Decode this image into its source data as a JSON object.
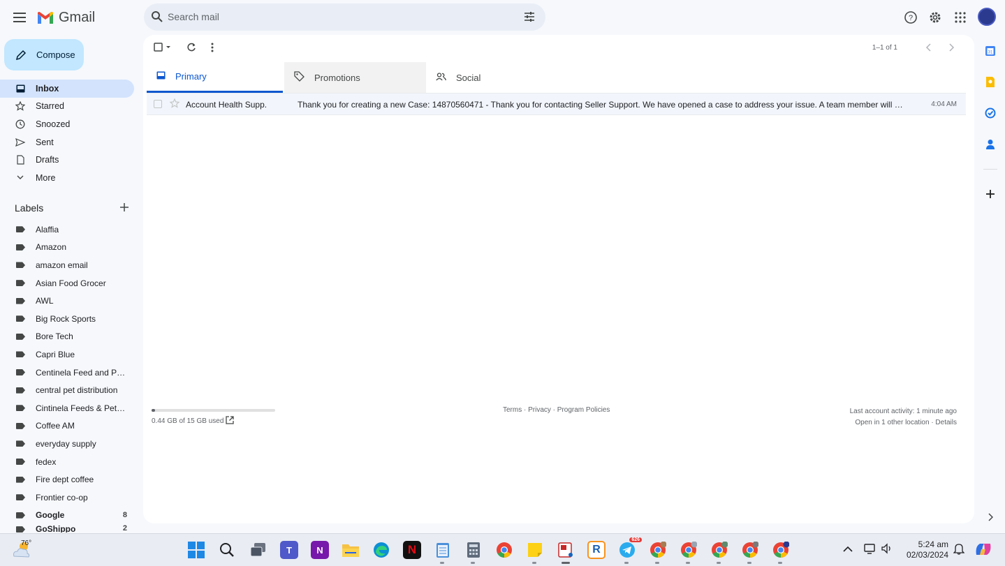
{
  "header": {
    "brand": "Gmail",
    "search_placeholder": "Search mail"
  },
  "compose_label": "Compose",
  "nav": [
    {
      "label": "Inbox",
      "icon": "inbox-icon",
      "active": true
    },
    {
      "label": "Starred",
      "icon": "star-icon"
    },
    {
      "label": "Snoozed",
      "icon": "clock-icon"
    },
    {
      "label": "Sent",
      "icon": "send-icon"
    },
    {
      "label": "Drafts",
      "icon": "draft-icon"
    },
    {
      "label": "More",
      "icon": "chevron-down-icon"
    }
  ],
  "labels_title": "Labels",
  "labels": [
    {
      "label": "Alaffia",
      "count": ""
    },
    {
      "label": "Amazon",
      "count": ""
    },
    {
      "label": "amazon email",
      "count": ""
    },
    {
      "label": "Asian Food Grocer",
      "count": ""
    },
    {
      "label": "AWL",
      "count": ""
    },
    {
      "label": "Big Rock Sports",
      "count": ""
    },
    {
      "label": "Bore Tech",
      "count": ""
    },
    {
      "label": "Capri Blue",
      "count": ""
    },
    {
      "label": "Centinela Feed and Pet ...",
      "count": ""
    },
    {
      "label": "central pet distribution",
      "count": ""
    },
    {
      "label": "Cintinela Feeds & Pet S...",
      "count": ""
    },
    {
      "label": "Coffee AM",
      "count": ""
    },
    {
      "label": "everyday supply",
      "count": ""
    },
    {
      "label": "fedex",
      "count": ""
    },
    {
      "label": "Fire dept coffee",
      "count": ""
    },
    {
      "label": "Frontier co-op",
      "count": ""
    },
    {
      "label": "Google",
      "count": "8",
      "bold": true
    },
    {
      "label": "GoShippo",
      "count": "2",
      "bold": true
    }
  ],
  "toolbar": {
    "pager": "1–1 of 1"
  },
  "tabs": {
    "primary": "Primary",
    "promotions": "Promotions",
    "social": "Social"
  },
  "email": {
    "sender": "Account Health Supp.",
    "snippet": "Thank you for creating a new Case: 14870560471 - Thank you for contacting Seller Support. We have opened a case to address your issue. A team member will follow up with you as soon as possible.",
    "time": "4:04 AM"
  },
  "footer": {
    "storage_fraction": 0.03,
    "storage_text": "0.44 GB of 15 GB used",
    "policies": "Terms · Privacy · Program Policies",
    "activity": "Last account activity: 1 minute ago",
    "other_location": "Open in 1 other location · Details"
  },
  "taskbar": {
    "temperature": "76°",
    "telegram_badge": "626",
    "time": "5:24 am",
    "date": "02/03/2024"
  },
  "colors": {
    "accent": "#0b57d0",
    "compose_bg": "#c2e7ff",
    "active_nav": "#d3e3fd"
  }
}
